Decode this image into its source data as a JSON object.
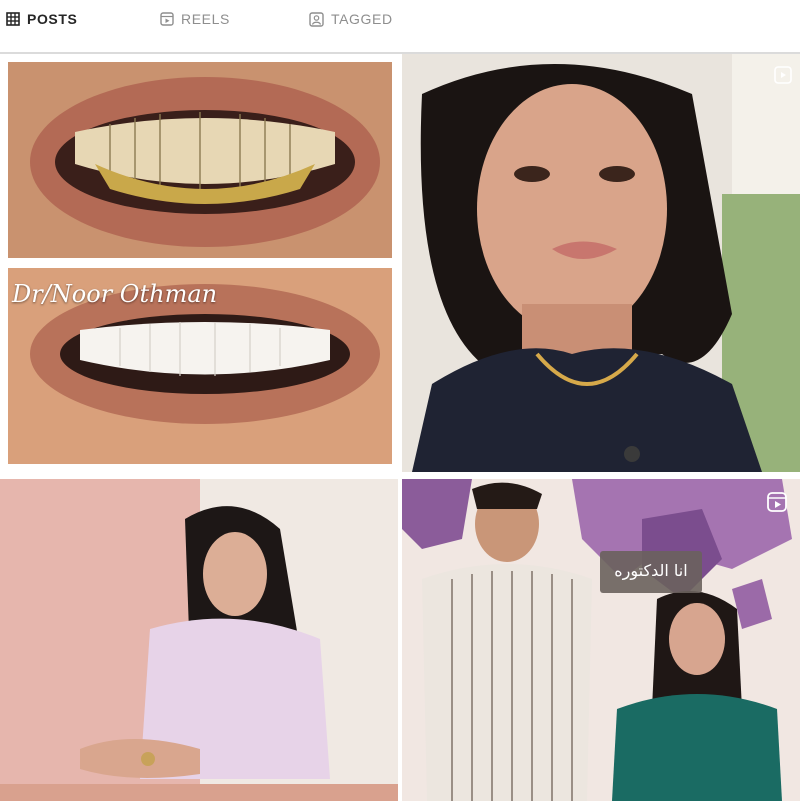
{
  "tabs": [
    {
      "label": "POSTS",
      "icon": "grid-icon",
      "active": true
    },
    {
      "label": "REELS",
      "icon": "reels-icon",
      "active": false
    },
    {
      "label": "TAGGED",
      "icon": "tagged-icon",
      "active": false
    }
  ],
  "posts": [
    {
      "type": "image",
      "overlay_text": "Dr/Noor Othman"
    },
    {
      "type": "reel",
      "overlay_text": ""
    },
    {
      "type": "image",
      "overlay_text": ""
    },
    {
      "type": "reel",
      "overlay_text": "انا الدكتوره"
    }
  ],
  "colors": {
    "active_tab": "#262626",
    "inactive_tab": "#8e8e8e",
    "divider": "#dbdbdb"
  }
}
